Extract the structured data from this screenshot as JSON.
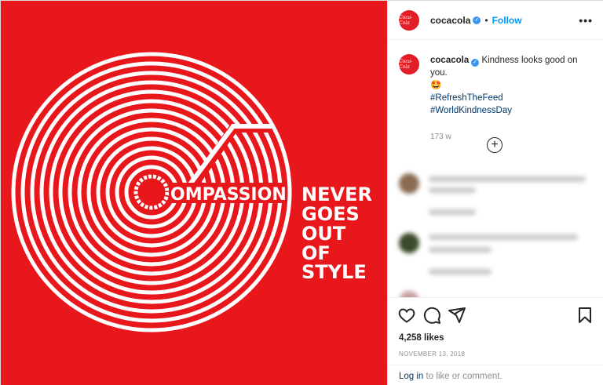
{
  "post": {
    "username": "cocacola",
    "verified_icon": "verified-badge-icon",
    "follow_label": "Follow",
    "more_icon": "more-options-icon",
    "avatar_text": "Coca-Cola",
    "brand_color": "#e41e26",
    "link_color": "#00376b",
    "follow_color": "#0095f6"
  },
  "caption": {
    "username": "cocacola",
    "text": "Kindness looks good on you.",
    "emoji": "🤩",
    "hashtags": [
      "#RefreshTheFeed",
      "#WorldKindnessDay"
    ],
    "age": "173 w"
  },
  "load_more_icon": "plus-circle-icon",
  "media": {
    "word1": "OMPASSION",
    "lines": [
      "NEVER",
      "GOES",
      "OUT",
      "OF",
      "STYLE"
    ],
    "background": "#e8171b"
  },
  "actions": {
    "like_icon": "heart-icon",
    "comment_icon": "comment-icon",
    "share_icon": "share-icon",
    "save_icon": "bookmark-icon"
  },
  "likes": "4,258 likes",
  "date": "NOVEMBER 13, 2018",
  "footer": {
    "login_label": "Log in",
    "rest": " to like or comment."
  }
}
